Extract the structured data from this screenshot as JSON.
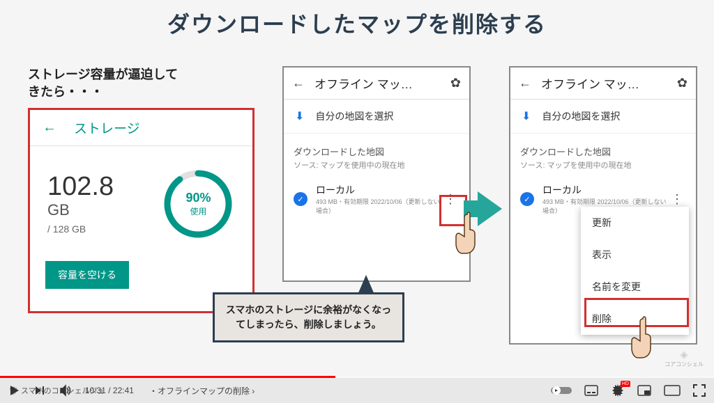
{
  "slide": {
    "title": "ダウンロードしたマップを削除する",
    "subtitle": "ストレージ容量が逼迫して\nきたら・・・"
  },
  "storage": {
    "header": "ストレージ",
    "used_value": "102.8",
    "used_unit": "GB",
    "total": "/ 128 GB",
    "percent": "90%",
    "percent_label": "使用",
    "free_button": "容量を空ける"
  },
  "phone": {
    "title": "オフライン マッ…",
    "select_map": "自分の地図を選択",
    "section": "ダウンロードした地図",
    "source": "ソース: マップを使用中の現在地",
    "map_name": "ローカル",
    "map_meta": "493 MB・有効期限 2022/10/06（更新しない場合）"
  },
  "menu": {
    "update": "更新",
    "view": "表示",
    "rename": "名前を変更",
    "delete": "削除"
  },
  "callout": "スマホのストレージに余裕がなくなってしまったら、削除しましょう。",
  "watermark": "コアコンシェル",
  "channel": "スマホのコンシェルジュ",
  "player": {
    "current": "10:31",
    "total": "22:41",
    "chapter": "・オフラインマップの削除",
    "hd": "HD"
  }
}
